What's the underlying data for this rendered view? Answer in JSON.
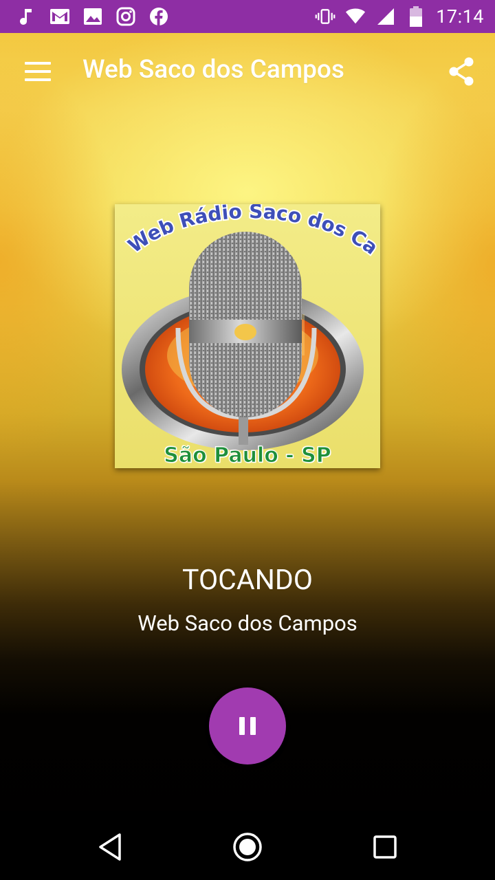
{
  "status_bar": {
    "time": "17:14",
    "left_icons": [
      "music-note-icon",
      "gmail-icon",
      "image-icon",
      "instagram-icon",
      "facebook-icon"
    ],
    "right_icons": [
      "vibrate-icon",
      "wifi-icon",
      "signal-icon",
      "battery-icon"
    ]
  },
  "app_bar": {
    "title": "Web Saco dos Campos",
    "menu_icon": "hamburger-menu-icon",
    "share_icon": "share-icon"
  },
  "album_art": {
    "top_text": "Web Rádio Saco dos Campos",
    "bottom_text": "São Paulo -  SP"
  },
  "player": {
    "status": "TOCANDO",
    "station": "Web Saco dos Campos",
    "control_icon": "pause-icon"
  },
  "colors": {
    "status_bar": "#8e2ea4",
    "accent": "#a13bb0"
  },
  "nav_bar": [
    "back-icon",
    "home-icon",
    "recents-icon"
  ]
}
